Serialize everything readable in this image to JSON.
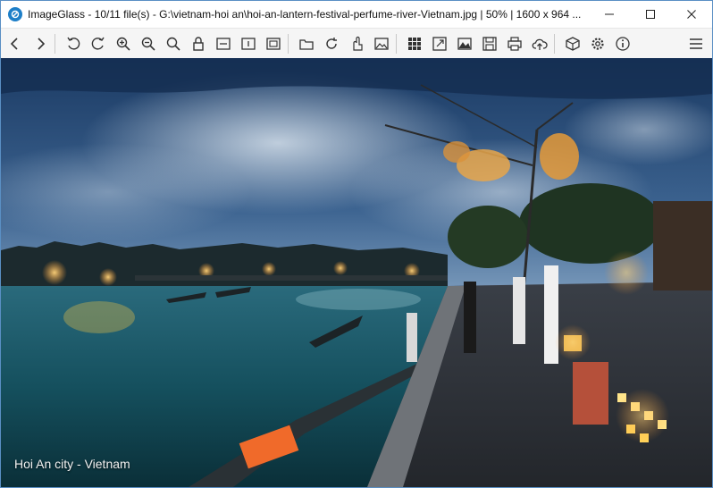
{
  "window": {
    "title": "ImageGlass - 10/11 file(s) - G:\\vietnam-hoi an\\hoi-an-lantern-festival-perfume-river-Vietnam.jpg  |  50%  |  1600 x 964 ...",
    "controls": [
      "minimize-icon",
      "maximize-icon",
      "close-icon"
    ]
  },
  "toolbar": {
    "buttons": [
      "back-icon",
      "forward-icon",
      "rotate-left-icon",
      "rotate-right-icon",
      "zoom-in-icon",
      "zoom-out-icon",
      "actual-size-icon",
      "lock-zoom-icon",
      "scale-width-icon",
      "scale-height-icon",
      "auto-zoom-icon",
      "open-file-icon",
      "refresh-icon",
      "go-to-image-icon",
      "gallery-icon",
      "thumbnail-bar-icon",
      "fullscreen-icon",
      "slideshow-icon",
      "save-icon",
      "print-icon",
      "upload-icon",
      "plugins-icon",
      "settings-icon",
      "about-icon",
      "menu-icon"
    ]
  },
  "viewer": {
    "caption": "Hoi An city - Vietnam",
    "zoom": "50%",
    "dimensions": "1600 x 964",
    "file_index": "10/11"
  }
}
